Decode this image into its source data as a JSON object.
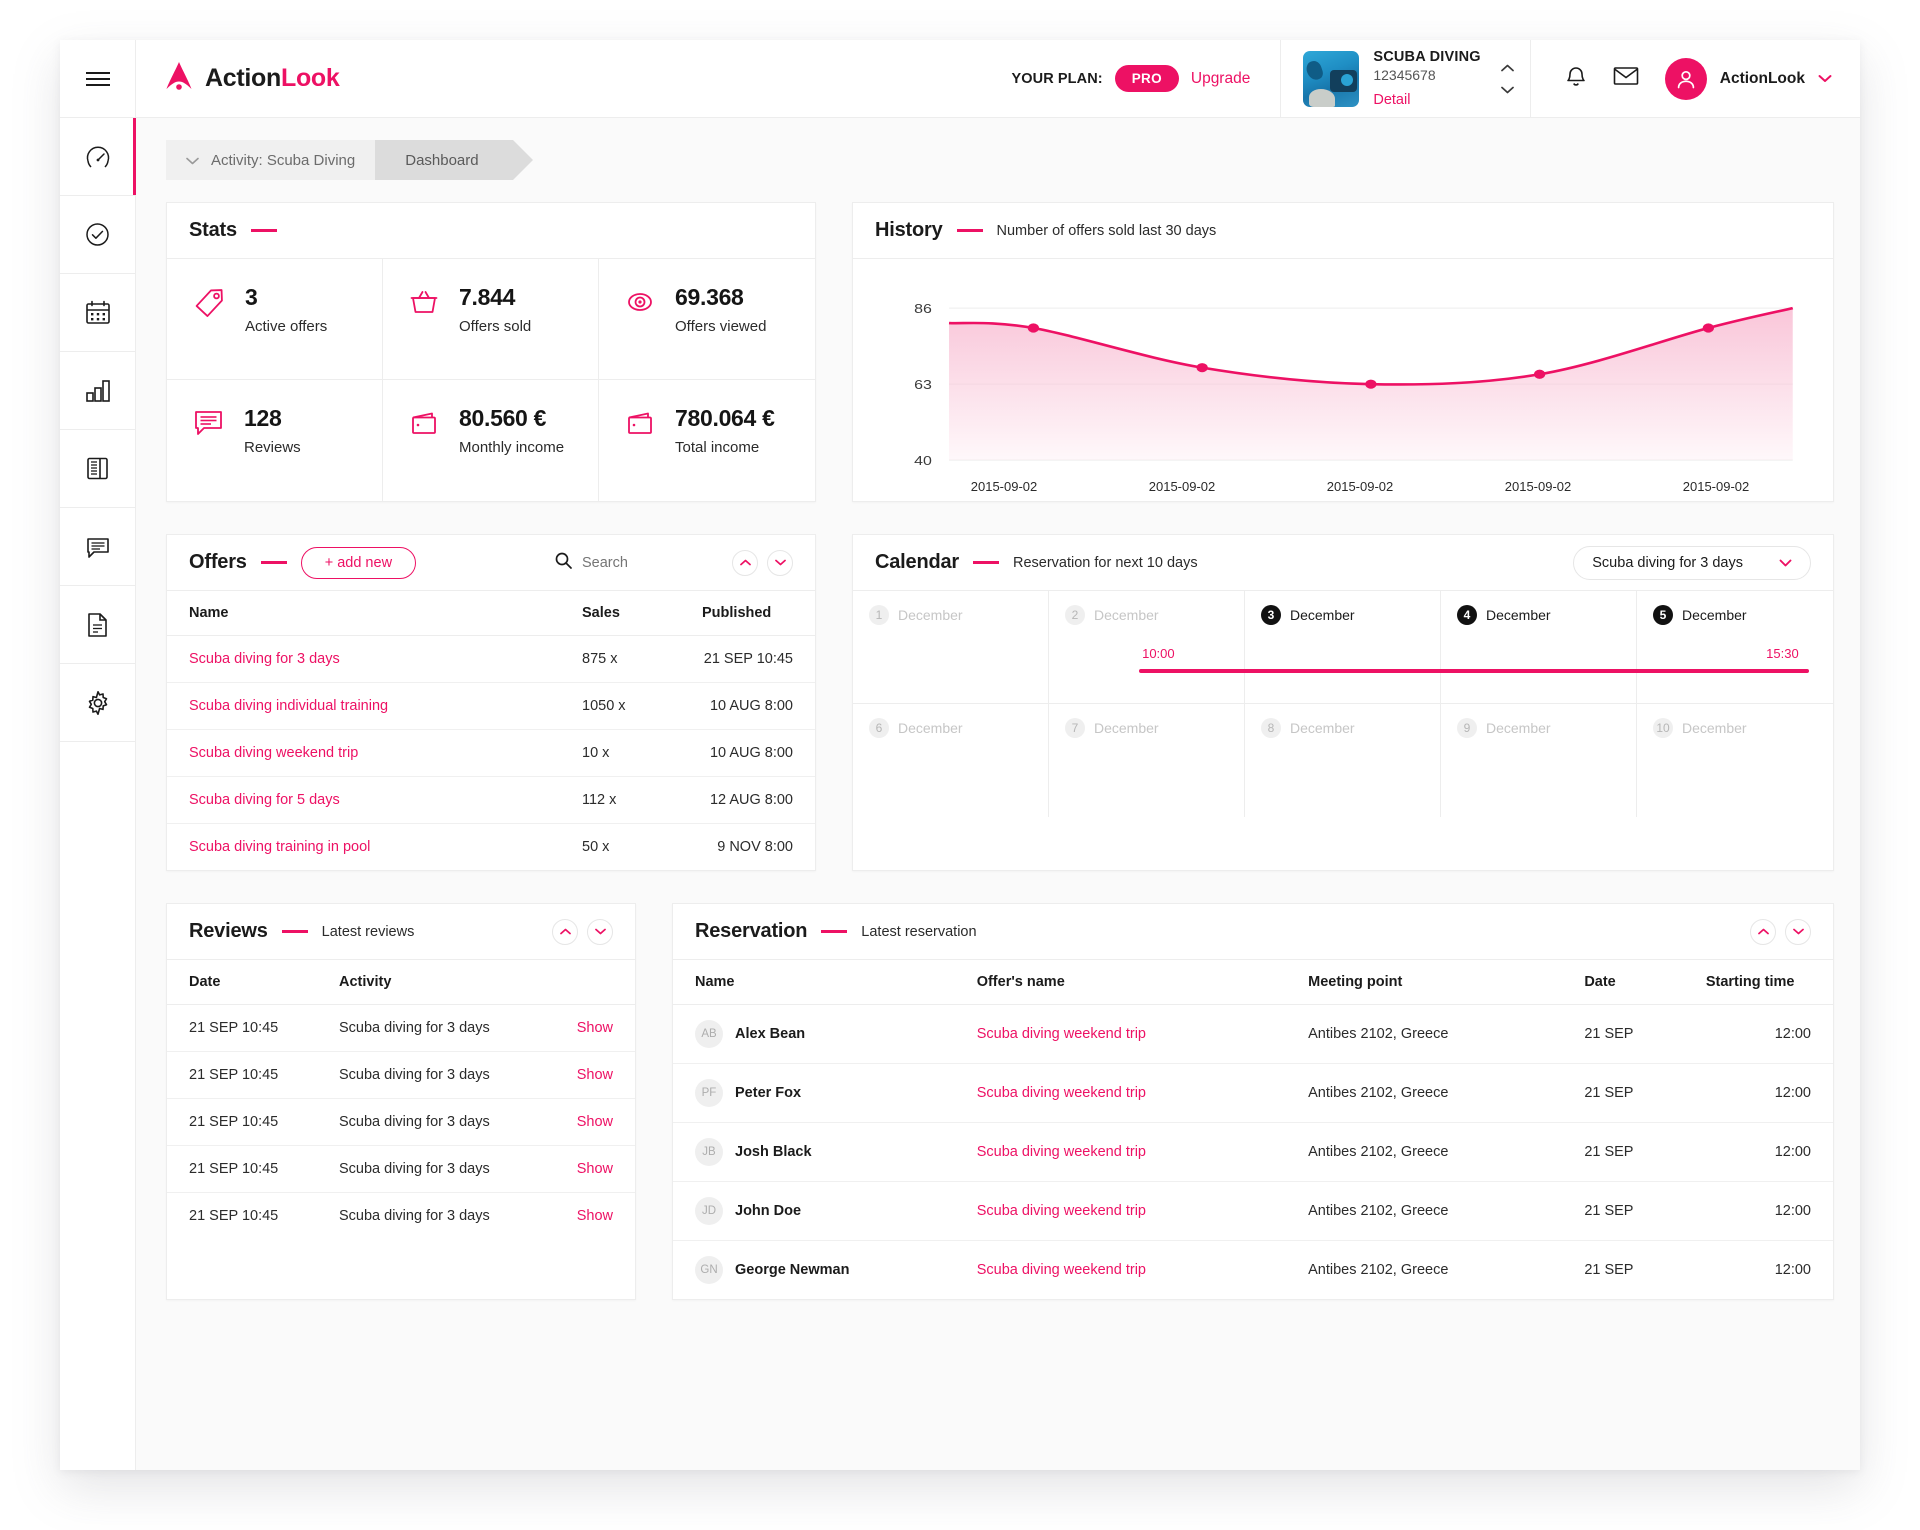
{
  "brand": {
    "name_dark": "Action",
    "name_pink": "Look",
    "accent": "#ED1164"
  },
  "sidebar": {
    "items": [
      {
        "icon": "hamburger-menu-icon",
        "name": "menu"
      },
      {
        "icon": "speedometer-icon",
        "name": "dashboard"
      },
      {
        "icon": "check-circle-icon",
        "name": "tasks"
      },
      {
        "icon": "calendar-icon",
        "name": "calendar"
      },
      {
        "icon": "bar-chart-icon",
        "name": "statistics"
      },
      {
        "icon": "notebook-icon",
        "name": "offers"
      },
      {
        "icon": "comment-icon",
        "name": "reviews"
      },
      {
        "icon": "document-icon",
        "name": "documents"
      },
      {
        "icon": "gear-icon",
        "name": "settings"
      }
    ]
  },
  "topbar": {
    "plan_label": "YOUR PLAN:",
    "plan_badge": "PRO",
    "upgrade_label": "Upgrade",
    "activity_name": "SCUBA DIVING",
    "activity_id": "12345678",
    "activity_detail": "Detail",
    "user_name": "ActionLook"
  },
  "breadcrumb": {
    "activity": "Activity: Scuba Diving",
    "current": "Dashboard"
  },
  "stats": {
    "title": "Stats",
    "cells": [
      {
        "icon": "tag-icon",
        "value": "3",
        "label": "Active offers"
      },
      {
        "icon": "basket-icon",
        "value": "7.844",
        "label": "Offers sold"
      },
      {
        "icon": "eye-icon",
        "value": "69.368",
        "label": "Offers viewed"
      },
      {
        "icon": "comment-icon",
        "value": "128",
        "label": "Reviews"
      },
      {
        "icon": "wallet-icon",
        "value": "80.560 €",
        "label": "Monthly income"
      },
      {
        "icon": "wallet-icon",
        "value": "780.064 €",
        "label": "Total income"
      }
    ]
  },
  "history": {
    "title": "History",
    "subtitle": "Number of offers sold last 30 days"
  },
  "chart_data": {
    "type": "area",
    "title": "History",
    "subtitle": "Number of offers sold last 30 days",
    "xlabel": "",
    "ylabel": "",
    "ylim": [
      40,
      90
    ],
    "yticks": [
      40,
      63,
      86
    ],
    "grid": true,
    "legend": "Number of offers sold last 30 days",
    "categories": [
      "2015-09-02",
      "2015-09-02",
      "2015-09-02",
      "2015-09-02",
      "2015-09-02"
    ],
    "values": [
      80,
      68,
      63,
      66,
      80
    ],
    "line_color": "#ED1164",
    "fill_color": "#F9C3D7"
  },
  "offers": {
    "title": "Offers",
    "add_label": "+ add new",
    "search_placeholder": "Search",
    "columns": [
      "Name",
      "Sales",
      "Published"
    ],
    "rows": [
      {
        "name": "Scuba diving for 3 days",
        "sales": "875 x",
        "published": "21 SEP 10:45"
      },
      {
        "name": "Scuba diving individual training",
        "sales": "1050 x",
        "published": "10 AUG 8:00"
      },
      {
        "name": "Scuba diving weekend trip",
        "sales": "10 x",
        "published": "10 AUG 8:00"
      },
      {
        "name": "Scuba diving for 5 days",
        "sales": "112 x",
        "published": "12 AUG 8:00"
      },
      {
        "name": "Scuba diving training in pool",
        "sales": "50 x",
        "published": "9 NOV 8:00"
      }
    ]
  },
  "calendar": {
    "title": "Calendar",
    "subtitle": "Reservation for next 10 days",
    "selected_offer": "Scuba diving for 3 days",
    "days": [
      {
        "num": "1",
        "month": "December",
        "active": false
      },
      {
        "num": "2",
        "month": "December",
        "active": false
      },
      {
        "num": "3",
        "month": "December",
        "active": true
      },
      {
        "num": "4",
        "month": "December",
        "active": true
      },
      {
        "num": "5",
        "month": "December",
        "active": true
      },
      {
        "num": "6",
        "month": "December",
        "active": false
      },
      {
        "num": "7",
        "month": "December",
        "active": false
      },
      {
        "num": "8",
        "month": "December",
        "active": false
      },
      {
        "num": "9",
        "month": "December",
        "active": false
      },
      {
        "num": "10",
        "month": "December",
        "active": false
      }
    ],
    "event_start_time": "10:00",
    "event_end_time": "15:30"
  },
  "reviews": {
    "title": "Reviews",
    "subtitle": "Latest reviews",
    "columns": [
      "Date",
      "Activity"
    ],
    "show_label": "Show",
    "rows": [
      {
        "date": "21 SEP 10:45",
        "activity": "Scuba diving for 3 days"
      },
      {
        "date": "21 SEP 10:45",
        "activity": "Scuba diving for 3 days"
      },
      {
        "date": "21 SEP 10:45",
        "activity": "Scuba diving for 3 days"
      },
      {
        "date": "21 SEP 10:45",
        "activity": "Scuba diving for 3 days"
      },
      {
        "date": "21 SEP 10:45",
        "activity": "Scuba diving for 3 days"
      }
    ]
  },
  "reservation": {
    "title": "Reservation",
    "subtitle": "Latest reservation",
    "columns": [
      "Name",
      "Offer's name",
      "Meeting point",
      "Date",
      "Starting time"
    ],
    "rows": [
      {
        "initials": "AB",
        "name": "Alex Bean",
        "offer": "Scuba diving weekend trip",
        "point": "Antibes 2102, Greece",
        "date": "21 SEP",
        "time": "12:00"
      },
      {
        "initials": "PF",
        "name": "Peter Fox",
        "offer": "Scuba diving weekend trip",
        "point": "Antibes 2102, Greece",
        "date": "21 SEP",
        "time": "12:00"
      },
      {
        "initials": "JB",
        "name": "Josh Black",
        "offer": "Scuba diving weekend trip",
        "point": "Antibes 2102, Greece",
        "date": "21 SEP",
        "time": "12:00"
      },
      {
        "initials": "JD",
        "name": "John Doe",
        "offer": "Scuba diving weekend trip",
        "point": "Antibes 2102, Greece",
        "date": "21 SEP",
        "time": "12:00"
      },
      {
        "initials": "GN",
        "name": "George Newman",
        "offer": "Scuba diving weekend trip",
        "point": "Antibes 2102, Greece",
        "date": "21 SEP",
        "time": "12:00"
      }
    ]
  }
}
